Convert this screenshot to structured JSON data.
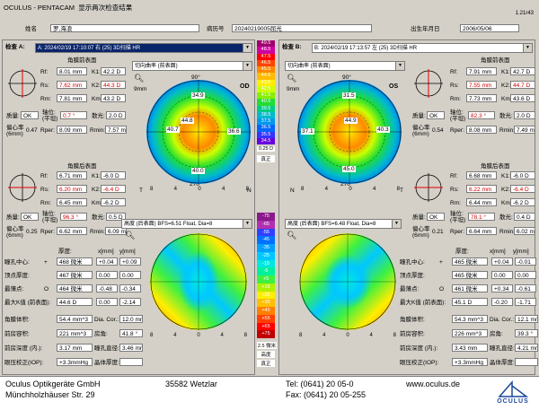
{
  "app": {
    "title": "OCULUS - PENTACAM",
    "subtitle": "显示两次检查结果",
    "version": "1.21r43"
  },
  "patient": {
    "name_label": "姓名",
    "name_value": "罗,海浪",
    "id_label": "病历号",
    "id_value": "20240219005屈光",
    "dob_label": "出生年月日",
    "dob_value": "2006/05/06"
  },
  "left": {
    "exam_label": "检查 A:",
    "exam_value": "A: 2024/02/19  17:10:07  右  (25) 3D扫描 HR",
    "front": {
      "title": "角膜前表面",
      "rf": "8.01 mm",
      "k1": "42.2 D",
      "rs": "7.62 mm",
      "k2": "44.3 D",
      "rm": "7.81 mm",
      "km": "43.2 D",
      "quality": "OK",
      "axis": "0.7 °",
      "astig": "2.0 D",
      "rper": "8.09 mm",
      "rmin": "7.57 mm",
      "decentered": "0.47"
    },
    "back": {
      "title": "角膜后表面",
      "rf": "6.71 mm",
      "k1": "-6.0 D",
      "rs": "6.20 mm",
      "k2": "-6.4 D",
      "rm": "6.45 mm",
      "km": "-6.2 D",
      "quality": "OK",
      "axis": "96.3 °",
      "astig": "0.5 D",
      "rper": "6.62 mm",
      "rmin": "6.09 mm",
      "decentered": "0.25"
    },
    "map1_select": "切向曲率 (前表面)",
    "map2_select": "高度 (后表面)  BFS=6.51 Float, Dia=8",
    "eye": "OD",
    "table": {
      "h_deg": "厚度:",
      "h_x": "x[mm]",
      "h_y": "y[mm]",
      "rows": [
        {
          "label": "瞳孔中心:",
          "sym": "+",
          "t": "468 微米",
          "x": "+0.04",
          "y": "+0.09"
        },
        {
          "label": "顶点厚度:",
          "sym": "",
          "t": "467 微米",
          "x": "0.00",
          "y": "0.00"
        },
        {
          "label": "最薄点:",
          "sym": "O",
          "t": "464 微米",
          "x": "-0.48",
          "y": "-0.34"
        },
        {
          "label": "最大K值 (前表面):",
          "sym": "",
          "t": "44.6 D",
          "x": "0.00",
          "y": "-2.14"
        }
      ]
    },
    "stats": [
      {
        "label": "角膜体积:",
        "v": "54.4 mm^3",
        "l2": "Dia. Cor.:",
        "v2": "12.0 mm"
      },
      {
        "label": "前房容积:",
        "v": "221 mm^3",
        "l2": "房角:",
        "v2": "41.8 °"
      },
      {
        "label": "前房深度 (内.):",
        "v": "3.17 mm",
        "l2": "瞳孔直径:",
        "v2": "3.46 mm"
      },
      {
        "label": "眼压校正(IOP):",
        "v": "+3.3mmHg",
        "l2": "晶体厚度:",
        "v2": ""
      }
    ],
    "tn": [
      "T",
      "N"
    ]
  },
  "right": {
    "exam_label": "检查 B:",
    "exam_value": "B: 2024/02/19  17:13:57  左  (25) 3D扫描 HR",
    "front": {
      "title": "角膜前表面",
      "rf": "7.91 mm",
      "k1": "42.7 D",
      "rs": "7.55 mm",
      "k2": "44.7 D",
      "rm": "7.73 mm",
      "km": "43.6 D",
      "quality": "OK",
      "axis": "82.3 °",
      "astig": "2.0 D",
      "rper": "8.08 mm",
      "rmin": "7.49 mm",
      "decentered": "0.54"
    },
    "back": {
      "title": "角膜后表面",
      "rf": "6.68 mm",
      "k1": "-6.0 D",
      "rs": "6.22 mm",
      "k2": "-6.4 D",
      "rm": "6.44 mm",
      "km": "-6.2 D",
      "quality": "OK",
      "axis": "78.1 °",
      "astig": "0.4 D",
      "rper": "6.64 mm",
      "rmin": "6.02 mm",
      "decentered": "0.21"
    },
    "map1_select": "切向曲率 (前表面)",
    "map2_select": "高度 (后表面)  BFS=6.48 Float, Dia=8",
    "eye": "OS",
    "table": {
      "h_deg": "厚度:",
      "h_x": "x[mm]",
      "h_y": "y[mm]",
      "rows": [
        {
          "label": "瞳孔中心:",
          "sym": "+",
          "t": "465 微米",
          "x": "+0.04",
          "y": "-0.01"
        },
        {
          "label": "顶点厚度:",
          "sym": "",
          "t": "465 微米",
          "x": "0.00",
          "y": "0.00"
        },
        {
          "label": "最薄点:",
          "sym": "O",
          "t": "461 微米",
          "x": "+0.34",
          "y": "-0.61"
        },
        {
          "label": "最大K值 (前表面):",
          "sym": "",
          "t": "45.1 D",
          "x": "-0.20",
          "y": "-1.71"
        }
      ]
    },
    "stats": [
      {
        "label": "角膜体积:",
        "v": "54.3 mm^3",
        "l2": "Dia. Cor.:",
        "v2": "12.1 mm"
      },
      {
        "label": "前房容积:",
        "v": "226 mm^3",
        "l2": "房角:",
        "v2": "39.3 °"
      },
      {
        "label": "前房深度 (内.):",
        "v": "3.43 mm",
        "l2": "瞳孔直径:",
        "v2": "4.21 mm"
      },
      {
        "label": "眼压校正(IOP):",
        "v": "+3.3mmHg",
        "l2": "晶体厚度:",
        "v2": ""
      }
    ],
    "tn": [
      "N",
      "T"
    ]
  },
  "labels": {
    "rf": "Rf:",
    "rs": "Rs:",
    "rm": "Rm:",
    "k1": "K1:",
    "k2": "K2:",
    "km": "Km:",
    "quality": "质量:",
    "axis": "轴位:",
    "axis2": "(平坦)",
    "astig": "散光:",
    "rper": "Rper:",
    "rmin": "Rmin:",
    "decentered": "偏心率",
    "decentered2": "(6mm)",
    "zoom": "9mm",
    "deg90": "90°",
    "deg270": "270°",
    "deg0": "0°",
    "deg180": "180°"
  },
  "scale": {
    "top": [
      "49.5",
      "48.5",
      "47.5",
      "46.5",
      "45.5",
      "44.5",
      "43.5",
      "42.5",
      "41.5",
      "40.5",
      "39.5",
      "38.5",
      "37.5",
      "36.5",
      "35.5",
      "34.5"
    ],
    "mid1": "0.25 D",
    "mid2": "真正",
    "bottom": [
      "-75",
      "-65",
      "-55",
      "-45",
      "-35",
      "-25",
      "-15",
      "-5",
      "+5",
      "+15",
      "+25",
      "+35",
      "+45",
      "+55",
      "+65",
      "+75"
    ],
    "bot1": "2.5 微米",
    "bot2": "高度",
    "bot3": "真正"
  },
  "colors": {
    "top": [
      "#a0006e",
      "#d0009e",
      "#ff0000",
      "#ff4400",
      "#ff8800",
      "#ffbb00",
      "#ffee00",
      "#ccff00",
      "#88ee00",
      "#22dd33",
      "#00cc88",
      "#00bbcc",
      "#0099ee",
      "#0066ff",
      "#3333ff",
      "#6600dd"
    ],
    "bottom": [
      "#8a1a8a",
      "#b030b0",
      "#3040ff",
      "#0070ff",
      "#00a0ff",
      "#00c8ff",
      "#00e8e0",
      "#00f0a0",
      "#40f040",
      "#b0f000",
      "#ffee00",
      "#ffc000",
      "#ff8000",
      "#ff4000",
      "#ff0000",
      "#c00000"
    ]
  },
  "footer": {
    "company": "Oculus Optikgeräte GmbH",
    "street": "Münchholzhäuser Str. 29",
    "city": "35582 Wetzlar",
    "tel": "Tel:  (0641) 20 05-0",
    "fax": "Fax: (0641) 20 05-255",
    "web": "www.oculus.de",
    "logo": "OCULUS"
  }
}
